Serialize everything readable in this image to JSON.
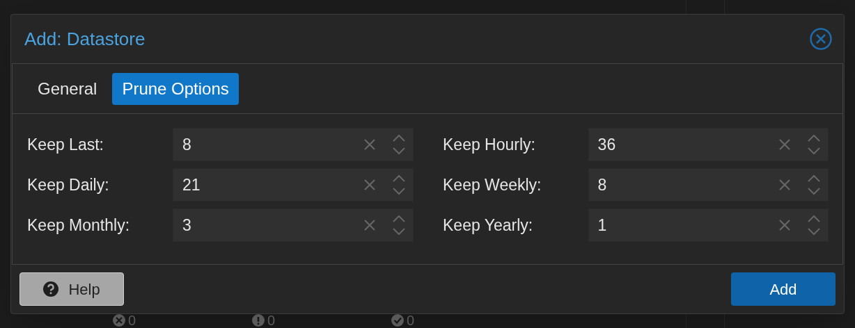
{
  "dialog": {
    "title": "Add: Datastore",
    "tabs": [
      {
        "label": "General",
        "selected": false
      },
      {
        "label": "Prune Options",
        "selected": true
      }
    ],
    "fields": [
      {
        "label": "Keep Last:",
        "value": "8"
      },
      {
        "label": "Keep Hourly:",
        "value": "36"
      },
      {
        "label": "Keep Daily:",
        "value": "21"
      },
      {
        "label": "Keep Weekly:",
        "value": "8"
      },
      {
        "label": "Keep Monthly:",
        "value": "3"
      },
      {
        "label": "Keep Yearly:",
        "value": "1"
      }
    ],
    "buttons": [
      {
        "kind": "help",
        "label": "Help"
      },
      {
        "kind": "primary",
        "label": "Add"
      }
    ]
  },
  "background_status": [
    {
      "kind": "error",
      "count": "0"
    },
    {
      "kind": "warning",
      "count": "0"
    },
    {
      "kind": "ok",
      "count": "0"
    }
  ]
}
